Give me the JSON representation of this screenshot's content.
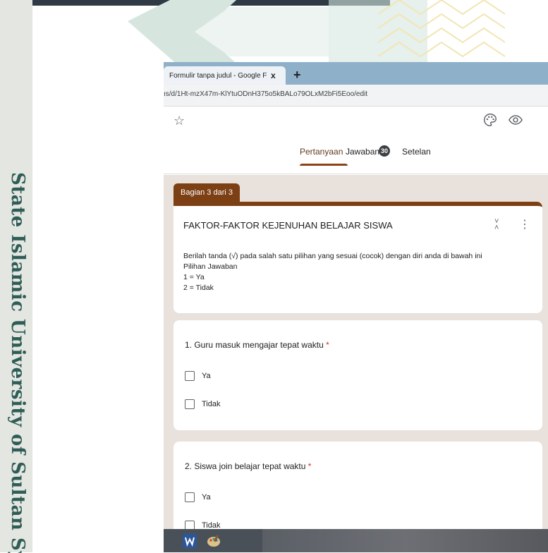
{
  "background": {
    "side_text": "State Islamic University of Sultan Syarif Kasim Riau"
  },
  "browser": {
    "tab_title": "Formulir tanpa judul - Google Formulir",
    "tab_close": "x",
    "new_tab": "+",
    "url": "ıs/d/1Ht-mzX47m-KlYtuODnH375o5kBALo79OLxM2bFi5Eoo/edit"
  },
  "form": {
    "star_icon": "☆",
    "tabs": [
      {
        "label": "Pertanyaan"
      },
      {
        "label": "Jawaban"
      },
      {
        "label": "Setelan"
      }
    ],
    "responses_badge": "30",
    "section_label": "Bagian 3 dari 3",
    "header_card": {
      "title": "FAKTOR-FAKTOR KEJENUHAN BELAJAR SISWA",
      "description_lines": [
        "Berilah tanda (√) pada salah satu pilihan yang sesuai (cocok) dengan diri anda di bawah ini",
        "Pilihan Jawaban",
        "1 = Ya",
        "2 = Tidak"
      ]
    },
    "questions": [
      {
        "title": "1. Guru masuk mengajar tepat waktu",
        "required_mark": "*",
        "options": [
          "Ya",
          "Tidak"
        ]
      },
      {
        "title": "2. Siswa join belajar tepat waktu",
        "required_mark": "*",
        "options": [
          "Ya",
          "Tidak"
        ]
      }
    ]
  },
  "colors": {
    "accent": "#7d3f14",
    "content_bg": "#e8e1dc",
    "required": "#d93025"
  }
}
